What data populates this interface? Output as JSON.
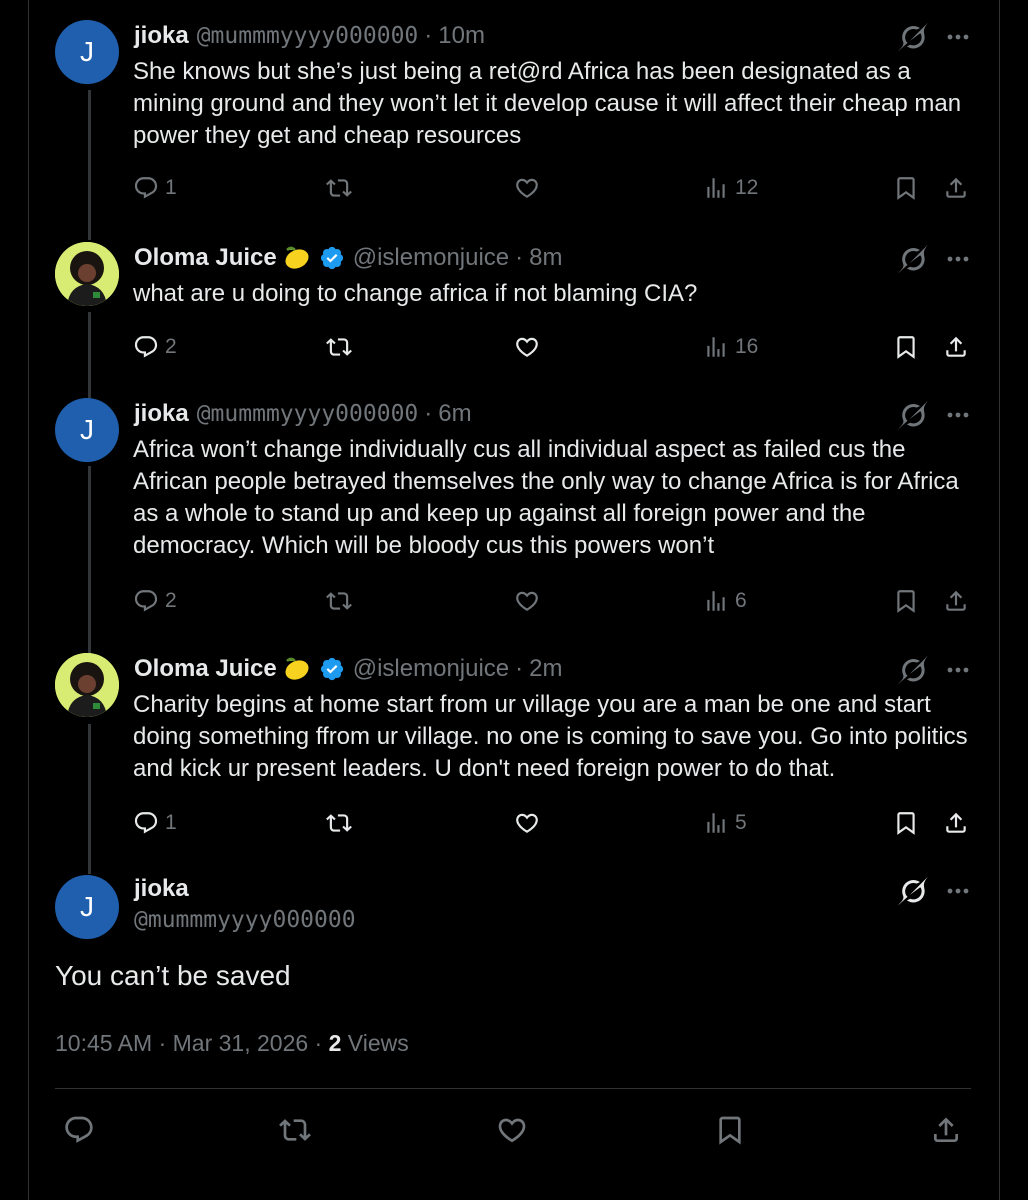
{
  "tweets": [
    {
      "name": "jioka",
      "handle": "@mummmyyyy000000",
      "time": "10m",
      "text": "She knows but she’s just being a ret@rd Africa has been designated as a mining ground and they won’t let it develop cause it will affect their cheap man power they get and cheap resources",
      "replies": "1",
      "views": "12",
      "avatar_letter": "J"
    },
    {
      "name": "Oloma Juice",
      "handle": "@islemonjuice",
      "time": "8m",
      "text": "what are u doing to change africa if not blaming CIA?",
      "replies": "2",
      "views": "16"
    },
    {
      "name": "jioka",
      "handle": "@mummmyyyy000000",
      "time": "6m",
      "text": "Africa won’t change individually cus all individual aspect as failed cus the African people betrayed themselves the only way to change Africa is for Africa as a whole to stand up and  keep up against all foreign power and the democracy. Which will be bloody cus this powers won’t",
      "replies": "2",
      "views": "6",
      "avatar_letter": "J"
    },
    {
      "name": "Oloma Juice",
      "handle": "@islemonjuice",
      "time": "2m",
      "text": "Charity begins at home start from ur village you are a man be one and start doing something ffrom ur village. no one is coming to save you. Go into politics and kick ur present leaders. U don't need foreign power to do that.",
      "replies": "1",
      "views": "5"
    }
  ],
  "main_tweet": {
    "name": "jioka",
    "handle": "@mummmyyyy000000",
    "avatar_letter": "J",
    "text": "You can’t be saved",
    "timestamp": "10:45 AM · Mar 31, 2026 · ",
    "views_count": "2",
    "views_label": "Views"
  },
  "separator": "·",
  "colors": {
    "background": "#000000",
    "text": "#e7e9ea",
    "muted": "#71767b",
    "verified": "#1d9bf0",
    "avatar_blue": "#1f5fae"
  },
  "icons": [
    "grok-icon",
    "more-icon",
    "reply-icon",
    "repost-icon",
    "like-icon",
    "views-icon",
    "bookmark-icon",
    "share-icon",
    "verified-icon",
    "lemon-emoji"
  ]
}
